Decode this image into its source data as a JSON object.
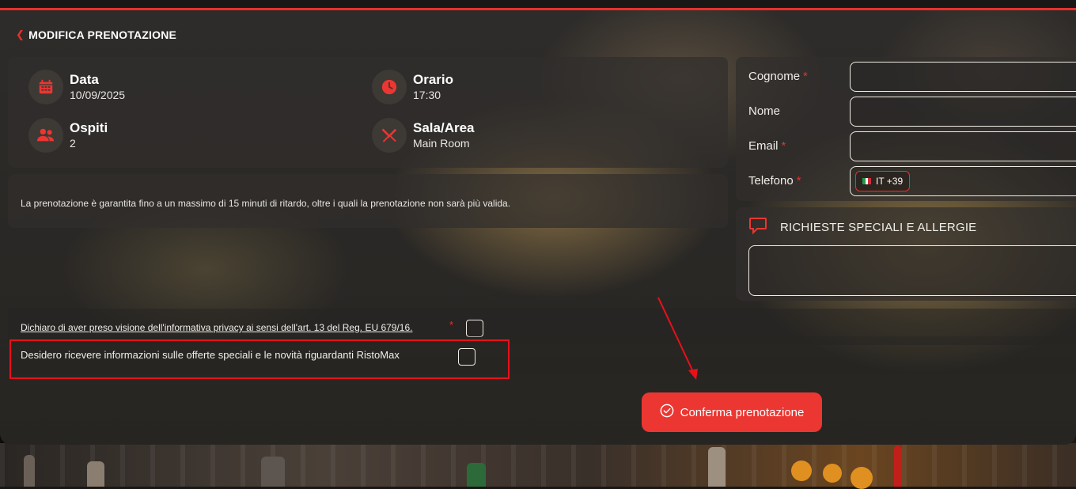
{
  "header": {
    "back_label": "MODIFICA PRENOTAZIONE"
  },
  "summary": {
    "date": {
      "label": "Data",
      "value": "10/09/2025",
      "icon": "calendar-icon"
    },
    "time": {
      "label": "Orario",
      "value": "17:30",
      "icon": "clock-icon"
    },
    "guests": {
      "label": "Ospiti",
      "value": "2",
      "icon": "people-icon"
    },
    "area": {
      "label": "Sala/Area",
      "value": "Main Room",
      "icon": "cutlery-icon"
    }
  },
  "note": "La prenotazione è garantita fino a un massimo di 15 minuti di ritardo, oltre i quali la prenotazione non sarà più valida.",
  "form": {
    "surname": {
      "label": "Cognome",
      "required": "*",
      "value": ""
    },
    "name": {
      "label": "Nome",
      "value": ""
    },
    "email": {
      "label": "Email",
      "required": "*",
      "value": ""
    },
    "phone": {
      "label": "Telefono",
      "required": "*",
      "prefix": "IT +39",
      "value": ""
    }
  },
  "requests": {
    "title": "RICHIESTE SPECIALI E ALLERGIE",
    "icon": "chat-icon",
    "value": ""
  },
  "consents": {
    "privacy": {
      "text": "Dichiaro di aver preso visione dell'informativa privacy ai sensi dell'art. 13 del Reg. EU 679/16.",
      "required": "*",
      "checked": false
    },
    "marketing": {
      "text": "Desidero ricevere informazioni sulle offerte speciali e le novità riguardanti RistoMax",
      "checked": false
    }
  },
  "confirm": {
    "label": "Conferma prenotazione",
    "icon": "check-circle-icon"
  },
  "colors": {
    "accent": "#ec3631",
    "highlight": "#e8111a"
  }
}
